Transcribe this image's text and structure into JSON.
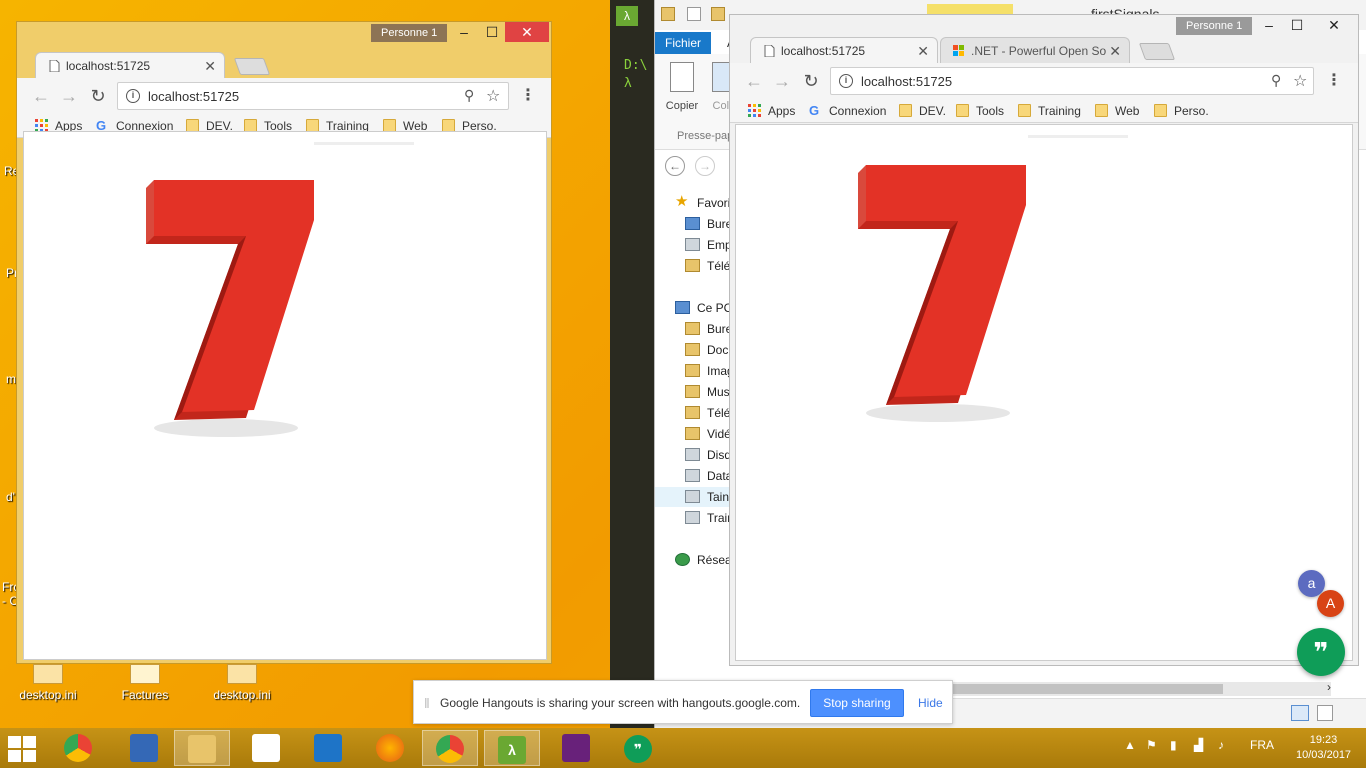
{
  "desktop": {
    "icons": [
      {
        "label": "desktop.ini"
      },
      {
        "label": "Factures"
      },
      {
        "label": "desktop.ini"
      }
    ],
    "edge_labels": [
      "Re",
      "Pr",
      "m",
      "d'",
      "Fro",
      "- C"
    ]
  },
  "left_window": {
    "profile": "Personne 1",
    "controls": {
      "minimize": "‒",
      "maximize": "☐",
      "close": "✕"
    },
    "tabs": [
      {
        "title": "localhost:51725",
        "close": "✕",
        "active": true
      }
    ],
    "url": "localhost:51725",
    "bookmarks": [
      "Apps",
      "Connexion",
      "DEV.",
      "Tools",
      "Training",
      "Web",
      "Perso."
    ],
    "content": {
      "number": "7"
    }
  },
  "right_window": {
    "profile": "Personne 1",
    "controls": {
      "minimize": "‒",
      "maximize": "☐",
      "close": "✕"
    },
    "tabs": [
      {
        "title": "localhost:51725",
        "close": "✕",
        "active": true
      },
      {
        "title": ".NET - Powerful Open So",
        "close": "✕",
        "active": false
      }
    ],
    "url": "localhost:51725",
    "bookmarks": [
      "Apps",
      "Connexion",
      "DEV.",
      "Tools",
      "Training",
      "Web",
      "Perso."
    ],
    "content": {
      "number": "7"
    }
  },
  "background_window_title": "firstSignals",
  "console": {
    "lines": [
      "D:\\",
      "λ"
    ]
  },
  "explorer": {
    "ribbon_tabs": [
      "Fichier",
      "A"
    ],
    "ribbon_buttons": [
      "Copier",
      "Coll"
    ],
    "ribbon_group": "Presse-pap",
    "tree": [
      {
        "label": "Favori",
        "icon": "star"
      },
      {
        "label": "Bure",
        "icon": "folder"
      },
      {
        "label": "Emp",
        "icon": "folder"
      },
      {
        "label": "Télé",
        "icon": "folder"
      },
      {
        "label": "Ce PC",
        "icon": "pc"
      },
      {
        "label": "Bure",
        "icon": "folder"
      },
      {
        "label": "Doc",
        "icon": "folder"
      },
      {
        "label": "Imag",
        "icon": "folder"
      },
      {
        "label": "Mus",
        "icon": "folder"
      },
      {
        "label": "Télé",
        "icon": "folder"
      },
      {
        "label": "Vidé",
        "icon": "folder"
      },
      {
        "label": "Disq",
        "icon": "drive"
      },
      {
        "label": "Data",
        "icon": "drive"
      },
      {
        "label": "Tain",
        "icon": "drive"
      },
      {
        "label": "Trair",
        "icon": "drive"
      },
      {
        "label": "Résea",
        "icon": "net"
      }
    ]
  },
  "hangouts": {
    "share_message": "Google Hangouts is sharing your screen with hangouts.google.com.",
    "stop_button": "Stop sharing",
    "hide_link": "Hide",
    "avatars": [
      {
        "letter": "a",
        "color": "#5c6bc0"
      },
      {
        "letter": "A",
        "color": "#d84315"
      }
    ],
    "fab_glyph": "❞"
  },
  "taskbar": {
    "apps": [
      {
        "name": "chrome-profile"
      },
      {
        "name": "remote-desktop"
      },
      {
        "name": "file-explorer"
      },
      {
        "name": "apps-grid"
      },
      {
        "name": "visual-studio-code"
      },
      {
        "name": "firefox"
      },
      {
        "name": "chrome"
      },
      {
        "name": "cmder"
      },
      {
        "name": "visual-studio"
      },
      {
        "name": "hangouts"
      }
    ],
    "language": "FRA",
    "time": "19:23",
    "date": "10/03/2017"
  }
}
